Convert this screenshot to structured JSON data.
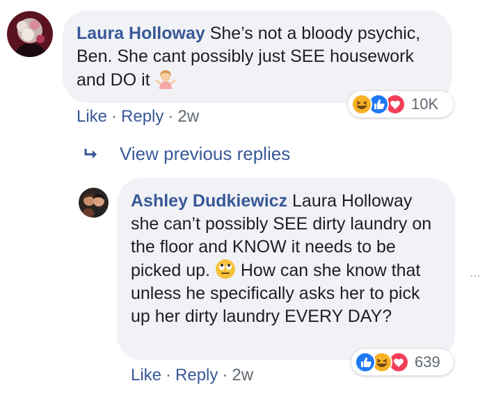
{
  "comment1": {
    "author": "Laura Holloway",
    "text": "She’s not a bloody psychic, Ben. She cant possibly just SEE housework and DO it",
    "emoji": "woman-shrugging-emoji",
    "reactions": {
      "icons": [
        "haha-icon",
        "like-icon",
        "love-icon"
      ],
      "count": "10K"
    },
    "actions": {
      "like": "Like",
      "reply": "Reply",
      "time": "2w"
    }
  },
  "view_previous": {
    "label": "View previous replies",
    "icon": "reply-arrow-icon"
  },
  "comment2": {
    "author": "Ashley Dudkiewicz",
    "text_before_emoji": "Laura Holloway she can’t possibly SEE dirty laundry on the floor and KNOW it needs to be picked up.",
    "emoji": "face-with-rolling-eyes-emoji",
    "text_after_emoji": "How can she know that unless he specifically asks her to pick up her dirty laundry EVERY DAY?",
    "reactions": {
      "icons": [
        "like-icon",
        "haha-icon",
        "love-icon"
      ],
      "count": "639"
    },
    "actions": {
      "like": "Like",
      "reply": "Reply",
      "time": "2w"
    }
  },
  "more_options": "···",
  "separator": "·",
  "colors": {
    "link": "#385898",
    "bubble": "#f1f2f6",
    "meta": "#606770",
    "like_blue": "#2078f4",
    "love_red": "#f33e58",
    "haha_yellow": "#f7b125"
  }
}
